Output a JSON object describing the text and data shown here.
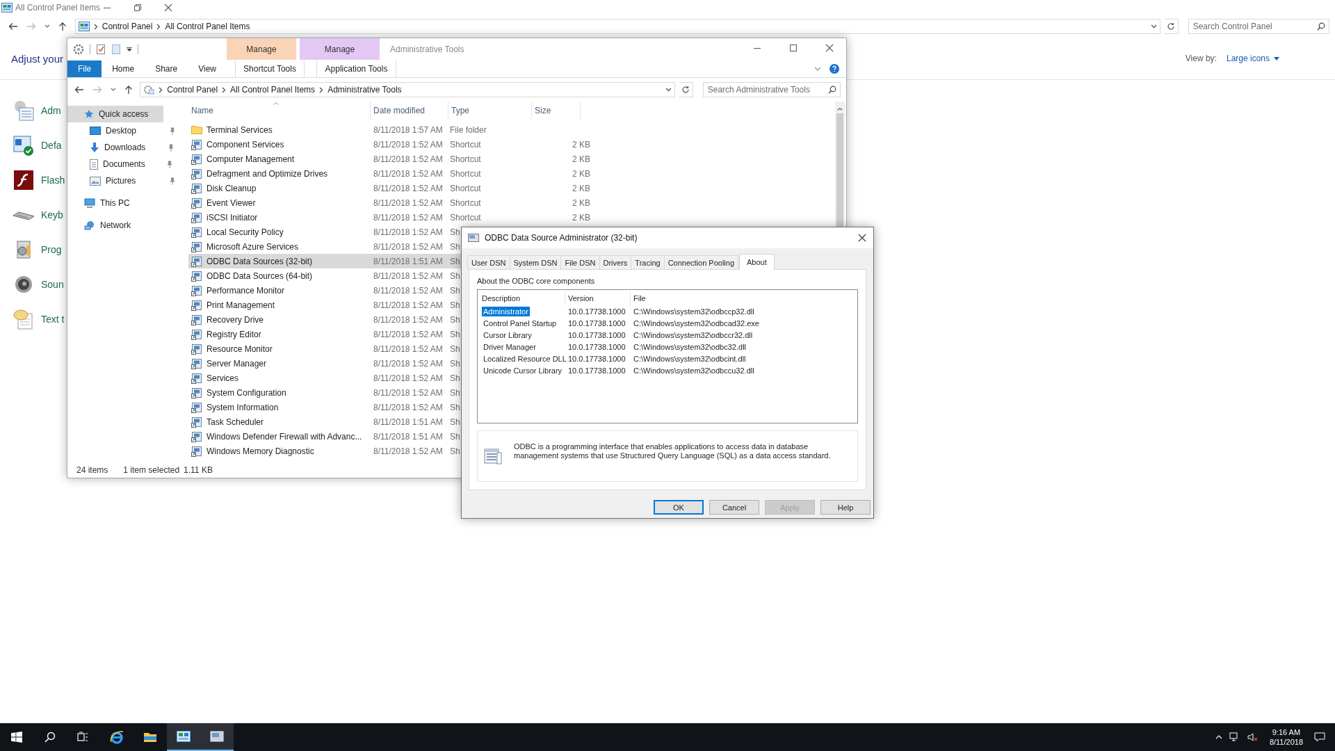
{
  "background_window": {
    "title": "All Control Panel Items",
    "breadcrumb": [
      "Control Panel",
      "All Control Panel Items"
    ],
    "search_placeholder": "Search Control Panel",
    "heading": "Adjust your",
    "view_by_label": "View by:",
    "view_by_value": "Large icons",
    "items": [
      {
        "label": "Adm",
        "kind": "tools"
      },
      {
        "label": "Defa",
        "kind": "defaults"
      },
      {
        "label": "Flash",
        "kind": "flash"
      },
      {
        "label": "Keyb",
        "kind": "keyboard"
      },
      {
        "label": "Prog",
        "kind": "programs"
      },
      {
        "label": "Soun",
        "kind": "sound"
      },
      {
        "label": "Text t",
        "kind": "speech"
      }
    ]
  },
  "explorer": {
    "title": "Administrative Tools",
    "context_tabs": [
      {
        "group": "Manage",
        "label": "Shortcut Tools",
        "color": "#fbd3b6"
      },
      {
        "group": "Manage",
        "label": "Application Tools",
        "color": "#e3c8f4"
      }
    ],
    "ribbon_tabs": [
      {
        "label": "File",
        "kind": "file"
      },
      {
        "label": "Home",
        "kind": "tab"
      },
      {
        "label": "Share",
        "kind": "tab"
      },
      {
        "label": "View",
        "kind": "tab"
      }
    ],
    "breadcrumb": [
      "Control Panel",
      "All Control Panel Items",
      "Administrative Tools"
    ],
    "search_placeholder": "Search Administrative Tools",
    "nav": [
      {
        "label": "Quick access",
        "kind": "star",
        "selected": true,
        "children": [
          {
            "label": "Desktop",
            "kind": "desktop",
            "selected": false,
            "pinned": true
          },
          {
            "label": "Downloads",
            "kind": "downloads",
            "selected": false,
            "pinned": true
          },
          {
            "label": "Documents",
            "kind": "documents",
            "selected": false,
            "pinned": true
          },
          {
            "label": "Pictures",
            "kind": "pictures",
            "selected": false,
            "pinned": true
          }
        ]
      },
      {
        "label": "This PC",
        "kind": "pc",
        "selected": false
      },
      {
        "label": "Network",
        "kind": "network",
        "selected": false
      }
    ],
    "columns": [
      "Name",
      "Date modified",
      "Type",
      "Size"
    ],
    "rows": [
      {
        "name": "Terminal Services",
        "date": "8/11/2018 1:57 AM",
        "type": "File folder",
        "kind": "folder",
        "selected": false
      },
      {
        "name": "Component Services",
        "date": "8/11/2018 1:52 AM",
        "type": "Shortcut",
        "size": "2 KB",
        "kind": "shortcut",
        "selected": false
      },
      {
        "name": "Computer Management",
        "date": "8/11/2018 1:52 AM",
        "type": "Shortcut",
        "size": "2 KB",
        "kind": "shortcut",
        "selected": false
      },
      {
        "name": "Defragment and Optimize Drives",
        "date": "8/11/2018 1:52 AM",
        "type": "Shortcut",
        "size": "2 KB",
        "kind": "shortcut",
        "selected": false
      },
      {
        "name": "Disk Cleanup",
        "date": "8/11/2018 1:52 AM",
        "type": "Shortcut",
        "size": "2 KB",
        "kind": "shortcut",
        "selected": false
      },
      {
        "name": "Event Viewer",
        "date": "8/11/2018 1:52 AM",
        "type": "Shortcut",
        "size": "2 KB",
        "kind": "shortcut",
        "selected": false
      },
      {
        "name": "iSCSI Initiator",
        "date": "8/11/2018 1:52 AM",
        "type": "Shortcut",
        "size": "2 KB",
        "kind": "shortcut",
        "selected": false
      },
      {
        "name": "Local Security Policy",
        "date": "8/11/2018 1:52 AM",
        "type": "Sh",
        "kind": "shortcut",
        "selected": false
      },
      {
        "name": "Microsoft Azure Services",
        "date": "8/11/2018 1:52 AM",
        "type": "Sh",
        "kind": "shortcut",
        "selected": false
      },
      {
        "name": "ODBC Data Sources (32-bit)",
        "date": "8/11/2018 1:51 AM",
        "type": "Sh",
        "kind": "shortcut",
        "selected": true
      },
      {
        "name": "ODBC Data Sources (64-bit)",
        "date": "8/11/2018 1:52 AM",
        "type": "Sh",
        "kind": "shortcut",
        "selected": false
      },
      {
        "name": "Performance Monitor",
        "date": "8/11/2018 1:52 AM",
        "type": "Sh",
        "kind": "shortcut",
        "selected": false
      },
      {
        "name": "Print Management",
        "date": "8/11/2018 1:52 AM",
        "type": "Sh",
        "kind": "shortcut",
        "selected": false
      },
      {
        "name": "Recovery Drive",
        "date": "8/11/2018 1:52 AM",
        "type": "Sh",
        "kind": "shortcut",
        "selected": false
      },
      {
        "name": "Registry Editor",
        "date": "8/11/2018 1:52 AM",
        "type": "Sh",
        "kind": "shortcut",
        "selected": false
      },
      {
        "name": "Resource Monitor",
        "date": "8/11/2018 1:52 AM",
        "type": "Sh",
        "kind": "shortcut",
        "selected": false
      },
      {
        "name": "Server Manager",
        "date": "8/11/2018 1:52 AM",
        "type": "Sh",
        "kind": "shortcut",
        "selected": false
      },
      {
        "name": "Services",
        "date": "8/11/2018 1:52 AM",
        "type": "Sh",
        "kind": "shortcut",
        "selected": false
      },
      {
        "name": "System Configuration",
        "date": "8/11/2018 1:52 AM",
        "type": "Sh",
        "kind": "shortcut",
        "selected": false
      },
      {
        "name": "System Information",
        "date": "8/11/2018 1:52 AM",
        "type": "Sh",
        "kind": "shortcut",
        "selected": false
      },
      {
        "name": "Task Scheduler",
        "date": "8/11/2018 1:51 AM",
        "type": "Sh",
        "kind": "shortcut",
        "selected": false
      },
      {
        "name": "Windows Defender Firewall with Advanc...",
        "date": "8/11/2018 1:51 AM",
        "type": "Sh",
        "kind": "shortcut",
        "selected": false
      },
      {
        "name": "Windows Memory Diagnostic",
        "date": "8/11/2018 1:52 AM",
        "type": "Sh",
        "kind": "shortcut",
        "selected": false
      }
    ],
    "status_count": "24 items",
    "status_selection": "1 item selected",
    "status_size": "1.11 KB"
  },
  "dialog": {
    "title": "ODBC Data Source Administrator (32-bit)",
    "tabs": [
      {
        "label": "User DSN",
        "selected": false
      },
      {
        "label": "System DSN",
        "selected": false
      },
      {
        "label": "File DSN",
        "selected": false
      },
      {
        "label": "Drivers",
        "selected": false
      },
      {
        "label": "Tracing",
        "selected": false
      },
      {
        "label": "Connection Pooling",
        "selected": false
      },
      {
        "label": "About",
        "selected": true
      }
    ],
    "group_label": "About the ODBC core components",
    "columns": [
      "Description",
      "Version",
      "File"
    ],
    "rows": [
      {
        "description": "Administrator",
        "version": "10.0.17738.1000",
        "file": "C:\\Windows\\system32\\odbccp32.dll",
        "selected": true
      },
      {
        "description": "Control Panel Startup",
        "version": "10.0.17738.1000",
        "file": "C:\\Windows\\system32\\odbcad32.exe",
        "selected": false
      },
      {
        "description": "Cursor Library",
        "version": "10.0.17738.1000",
        "file": "C:\\Windows\\system32\\odbccr32.dll",
        "selected": false
      },
      {
        "description": "Driver Manager",
        "version": "10.0.17738.1000",
        "file": "C:\\Windows\\system32\\odbc32.dll",
        "selected": false
      },
      {
        "description": "Localized Resource DLL",
        "version": "10.0.17738.1000",
        "file": "C:\\Windows\\system32\\odbcint.dll",
        "selected": false
      },
      {
        "description": "Unicode Cursor Library",
        "version": "10.0.17738.1000",
        "file": "C:\\Windows\\system32\\odbccu32.dll",
        "selected": false
      }
    ],
    "info_text": "ODBC is a programming interface that enables applications to access data in database management systems that use Structured Query Language (SQL) as a data access standard.",
    "buttons": [
      {
        "label": "OK",
        "default": true,
        "disabled": false
      },
      {
        "label": "Cancel",
        "default": false,
        "disabled": false
      },
      {
        "label": "Apply",
        "default": false,
        "disabled": true
      },
      {
        "label": "Help",
        "default": false,
        "disabled": false
      }
    ]
  },
  "taskbar": {
    "apps": [
      {
        "kind": "start",
        "active": false
      },
      {
        "kind": "search",
        "active": false
      },
      {
        "kind": "taskview",
        "active": false
      },
      {
        "kind": "browser",
        "active": false
      },
      {
        "kind": "folder",
        "active": false
      },
      {
        "kind": "controlpanel",
        "active": true
      },
      {
        "kind": "odbc",
        "active": true
      }
    ],
    "time": "9:16 AM",
    "date": "8/11/2018"
  }
}
